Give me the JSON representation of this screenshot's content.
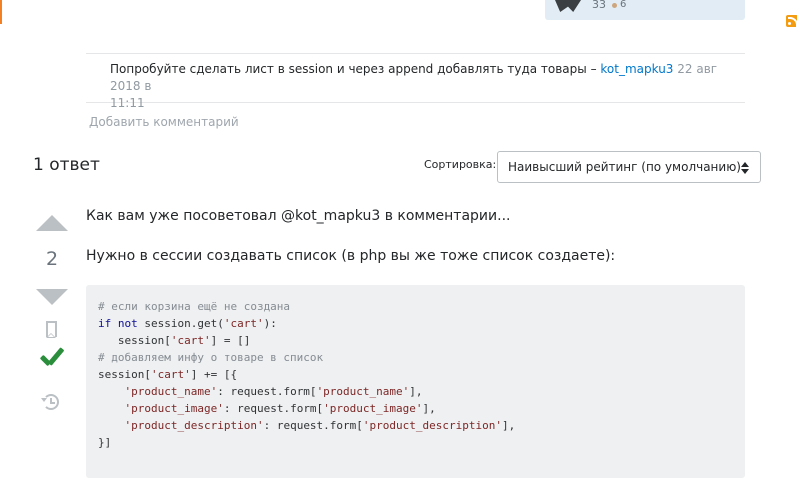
{
  "user_card": {
    "reputation": "33",
    "bronze_badges": "6"
  },
  "comment": {
    "text": "Попробуйте сделать лист в session и через append добавлять туда товары – ",
    "author": "kot_mapku3",
    "date_line1": " 22 авг 2018 в",
    "date_line2": "11:11"
  },
  "add_comment_label": "Добавить комментарий",
  "answers_header": "1 ответ",
  "sort": {
    "label": "Сортировка:",
    "selected": "Наивысший рейтинг (по умолчанию)"
  },
  "answer": {
    "vote_count": "2",
    "paragraph1": "Как вам уже посоветовал @kot_mapku3 в комментарии...",
    "paragraph2": "Нужно в сессии создавать список (в php вы же тоже список создаете):",
    "code_lines": [
      "# если корзина ещё не создана",
      "if not session.get('cart'):",
      "   session['cart'] = []",
      "",
      "# добавляем инфу о товаре в список",
      "session['cart'] += [{",
      "    'product_name': request.form['product_name'],",
      "    'product_image': request.form['product_image'],",
      "    'product_description': request.form['product_description'],",
      "}]"
    ]
  },
  "icons": {
    "vote_up": "arrow-up-icon",
    "vote_down": "arrow-down-icon",
    "bookmark": "bookmark-icon",
    "accepted": "checkmark-icon",
    "history": "history-icon",
    "rss": "rss-icon"
  },
  "colors": {
    "link": "#0077cc",
    "accepted": "#2b8e3c",
    "code_background": "#eff0f1",
    "accent": "#f48024"
  }
}
